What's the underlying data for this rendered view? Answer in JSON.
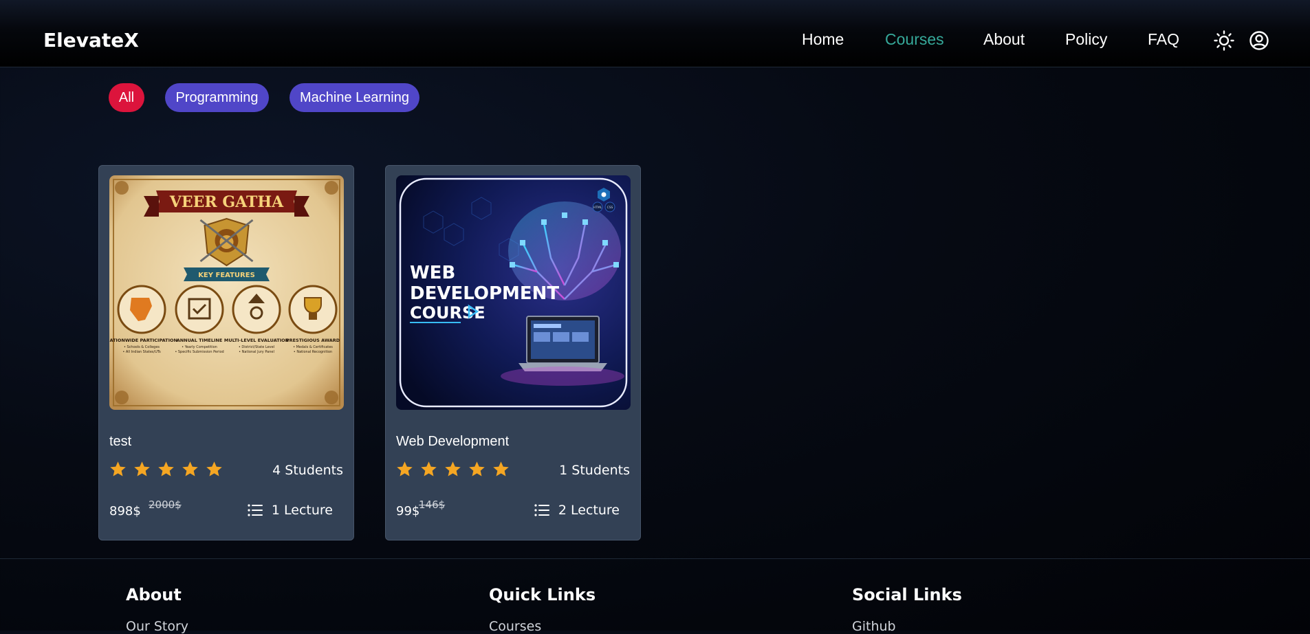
{
  "header": {
    "brand": "ElevateX",
    "nav": [
      "Home",
      "Courses",
      "About",
      "Policy",
      "FAQ"
    ],
    "active_nav": "Courses",
    "icons": [
      "sun-icon",
      "user-circle-icon"
    ]
  },
  "filters": {
    "items": [
      "All",
      "Programming",
      "Machine Learning"
    ],
    "active": "All",
    "colors": {
      "active": "#dc143c",
      "inactive": "#5046c8"
    }
  },
  "courses": [
    {
      "title": "test",
      "rating": 5,
      "students": "4 Students",
      "price": "898$",
      "old_price": "2000$",
      "lectures": "1 Lecture",
      "thumbnail": {
        "banner": "VEER GATHA",
        "ribbon": "KEY FEATURES",
        "features": [
          {
            "title": "NATIONWIDE PARTICIPATION",
            "lines": [
              "• Schools & Colleges",
              "• All Indian States/UTs"
            ]
          },
          {
            "title": "ANNUAL TIMELINE",
            "lines": [
              "• Yearly Competition",
              "• Specific Submission Period"
            ]
          },
          {
            "title": "MULTI-LEVEL EVALUATION",
            "lines": [
              "• District/State Level",
              "• National Jury Panel"
            ]
          },
          {
            "title": "PRESTIGIOUS AWARD",
            "lines": [
              "• Medals & Certificates",
              "• National Recognition"
            ]
          }
        ]
      }
    },
    {
      "title": "Web Development",
      "rating": 5,
      "students": "1 Students",
      "price": "99$",
      "old_price": "146$",
      "lectures": "2 Lecture",
      "thumbnail": {
        "heading_lines": [
          "WEB",
          "DEVELOPMENT",
          "COURSE"
        ],
        "badge_labels": [
          "HTML",
          "CSS"
        ]
      }
    }
  ],
  "footer": {
    "columns": [
      {
        "heading": "About",
        "first_link": "Our Story"
      },
      {
        "heading": "Quick Links",
        "first_link": "Courses"
      },
      {
        "heading": "Social Links",
        "first_link": "Github"
      }
    ]
  },
  "colors": {
    "accent": "#36a99a",
    "card_bg": "#334155",
    "star": "#f5a623"
  }
}
